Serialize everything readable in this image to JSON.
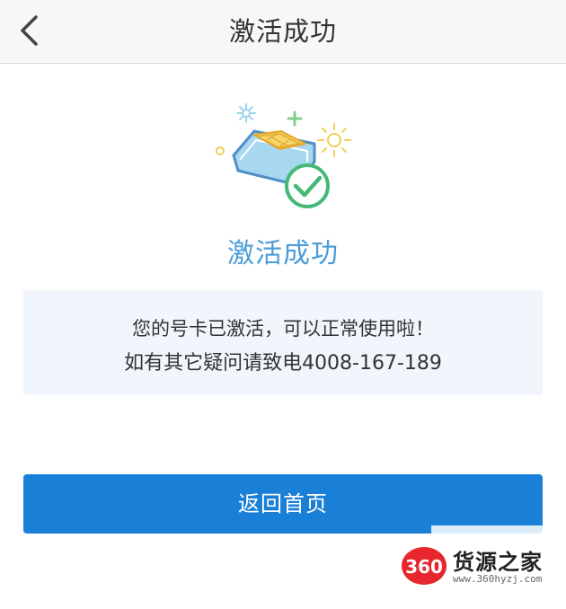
{
  "header": {
    "back_icon": "chevron-left-icon",
    "title": "激活成功"
  },
  "illustration": {
    "icon": "sim-card-activated-icon",
    "colors": {
      "card": "#4f8fc7",
      "card_fill": "#a8d7f0",
      "chip": "#f3c94f",
      "check": "#46b978",
      "sparkle": "#f0cf5a"
    }
  },
  "main": {
    "success_title": "激活成功",
    "message_line1": "您的号卡已激活，可以正常使用啦！",
    "message_line2": "如有其它疑问请致电4008-167-189",
    "home_button_label": "返回首页"
  },
  "watermark": {
    "badge_text": "360",
    "brand": "货源之家",
    "url": "www.360hyzj.com"
  },
  "colors": {
    "accent": "#4a9cd9",
    "button": "#1a7fd6",
    "message_bg": "#f0f6fb",
    "header_bg": "#f7f7f7"
  }
}
